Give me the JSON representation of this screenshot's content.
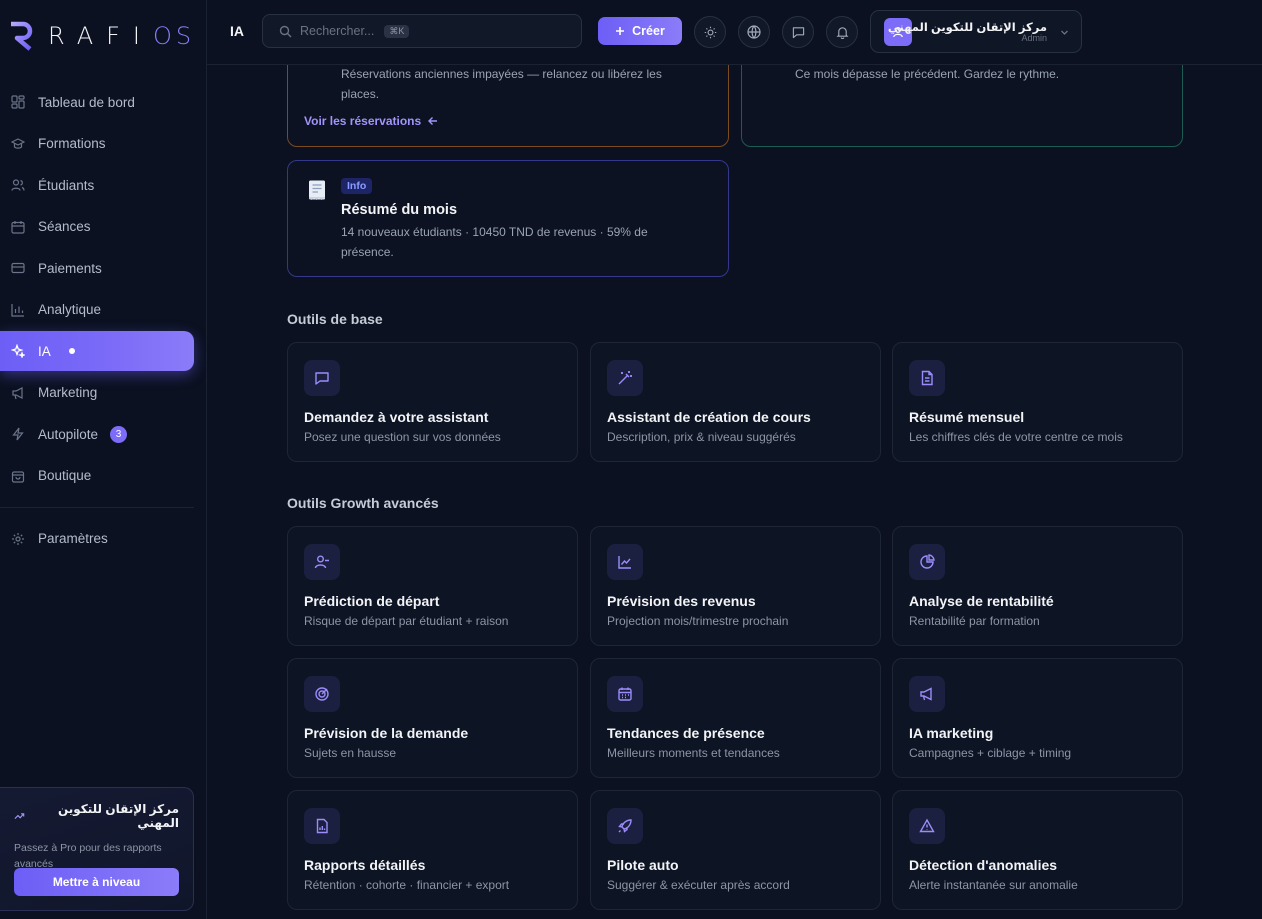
{
  "brand": {
    "logo_text": "RAFI",
    "logo_suffix": "OS"
  },
  "sidebar": {
    "items": [
      {
        "label": "Tableau de bord",
        "icon": "dashboard-icon"
      },
      {
        "label": "Formations",
        "icon": "graduation-cap-icon"
      },
      {
        "label": "Étudiants",
        "icon": "users-icon"
      },
      {
        "label": "Séances",
        "icon": "calendar-icon"
      },
      {
        "label": "Paiements",
        "icon": "credit-card-icon"
      },
      {
        "label": "Analytique",
        "icon": "bar-chart-icon"
      },
      {
        "label": "IA",
        "icon": "sparkles-icon",
        "active": true
      },
      {
        "label": "Marketing",
        "icon": "megaphone-icon"
      },
      {
        "label": "Autopilote",
        "icon": "zap-icon",
        "badge": "3"
      },
      {
        "label": "Boutique",
        "icon": "shopping-bag-icon"
      }
    ],
    "settings_label": "Paramètres",
    "promo": {
      "title": "مركز الإتقان للتكوين المهني",
      "subtitle": "Passez à Pro pour des rapports avancés",
      "button": "Mettre à niveau"
    }
  },
  "header": {
    "page_label": "IA",
    "search_placeholder": "Rechercher...",
    "search_shortcut": "⌘K",
    "create_label": "Créer",
    "account_name": "مركز الإتقان للتكوين المهني",
    "account_role": "Admin"
  },
  "alerts": {
    "warning": {
      "text": "Réservations anciennes impayées — relancez ou libérez les places.",
      "link": "Voir les réservations"
    },
    "success": {
      "text": "Ce mois dépasse le précédent. Gardez le rythme."
    },
    "info": {
      "pill": "Info",
      "title": "Résumé du mois",
      "text": "14 nouveaux étudiants · 10450 TND de revenus · 59% de présence."
    }
  },
  "sections": {
    "base_title": "Outils de base",
    "growth_title": "Outils Growth avancés"
  },
  "base_tools": [
    {
      "title": "Demandez à votre assistant",
      "desc": "Posez une question sur vos données",
      "icon": "message-square-icon"
    },
    {
      "title": "Assistant de création de cours",
      "desc": "Description, prix & niveau suggérés",
      "icon": "magic-wand-icon"
    },
    {
      "title": "Résumé mensuel",
      "desc": "Les chiffres clés de votre centre ce mois",
      "icon": "file-text-icon"
    }
  ],
  "growth_tools": [
    {
      "title": "Prédiction de départ",
      "desc": "Risque de départ par étudiant + raison",
      "icon": "user-minus-icon"
    },
    {
      "title": "Prévision des revenus",
      "desc": "Projection mois/trimestre prochain",
      "icon": "line-chart-icon"
    },
    {
      "title": "Analyse de rentabilité",
      "desc": "Rentabilité par formation",
      "icon": "pie-chart-icon"
    },
    {
      "title": "Prévision de la demande",
      "desc": "Sujets en hausse",
      "icon": "radar-icon"
    },
    {
      "title": "Tendances de présence",
      "desc": "Meilleurs moments et tendances",
      "icon": "calendar-grid-icon"
    },
    {
      "title": "IA marketing",
      "desc": "Campagnes + ciblage + timing",
      "icon": "megaphone-icon"
    },
    {
      "title": "Rapports détaillés",
      "desc": "Rétention · cohorte · financier + export",
      "icon": "file-chart-icon"
    },
    {
      "title": "Pilote auto",
      "desc": "Suggérer & exécuter après accord",
      "icon": "rocket-icon"
    },
    {
      "title": "Détection d'anomalies",
      "desc": "Alerte instantanée sur anomalie",
      "icon": "alert-triangle-icon"
    }
  ],
  "colors": {
    "accent": "#7c6cf8",
    "background": "#0b1120",
    "card": "#0d1424",
    "warning_border": "#7a4b1c",
    "success_border": "#1d5c52",
    "info_border": "#33388a"
  }
}
